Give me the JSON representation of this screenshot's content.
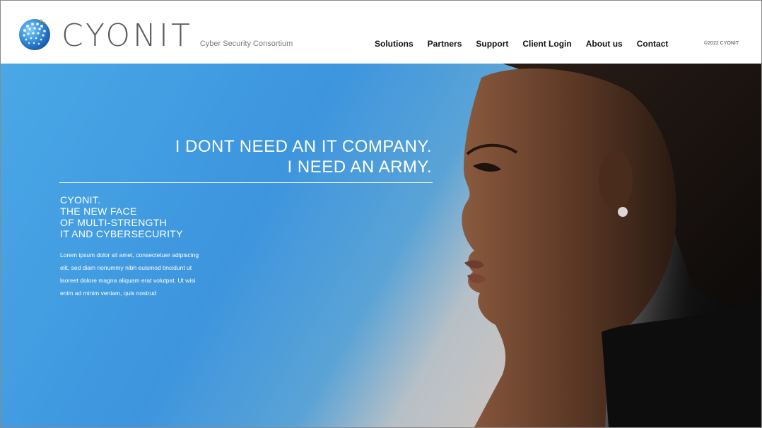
{
  "brand": {
    "name": "CYONIT",
    "tagline": "Cyber Security Consortium"
  },
  "nav": {
    "items": [
      "Solutions",
      "Partners",
      "Support",
      "Client Login",
      "About us",
      "Contact"
    ]
  },
  "copyright": "©2022 CYONIT",
  "hero": {
    "headline_line1": "I DONT NEED AN IT COMPANY.",
    "headline_line2": "I NEED AN ARMY.",
    "subhead": [
      "CYONIT.",
      "THE NEW FACE",
      "OF MULTI-STRENGTH",
      "IT AND CYBERSECURITY"
    ],
    "body": "Lorem ipsum dolor sit amet, consectetuer adipiscing elit, sed diam nonummy nibh euismod tincidunt ut laoreet dolore magna aliquam erat volutpat. Ut wisi enim ad minim veniam, quis nostrud"
  },
  "colors": {
    "hero_blue": "#3d95de",
    "text_dark": "#111111",
    "brand_grey": "#5b5b5b"
  }
}
